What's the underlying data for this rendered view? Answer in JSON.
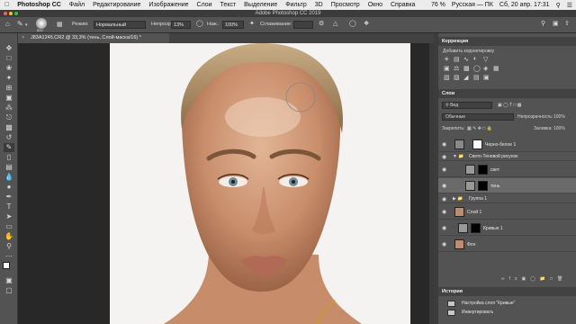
{
  "menubar": {
    "app": "Photoshop CC",
    "items": [
      "Файл",
      "Редактирование",
      "Изображение",
      "Слои",
      "Текст",
      "Выделение",
      "Фильтр",
      "3D",
      "Просмотр",
      "Окно",
      "Справка"
    ],
    "battery": "76 %",
    "keyboard": "Русская — ПК",
    "datetime": "Сб, 20 апр. 17:31"
  },
  "window": {
    "title": "Adobe Photoshop CC 2019"
  },
  "options": {
    "brush_size": "800",
    "mode_label": "Режим:",
    "mode_value": "Нормальный",
    "opacity_label": "Непрозр.:",
    "opacity_value": "13%",
    "pressure_label": "Наж.:",
    "pressure_value": "100%",
    "smoothing_label": "Сглаживание:"
  },
  "document": {
    "tab": "J83A1245.CR2 @ 33,3% (тень, Слой-маска/16) *"
  },
  "corrections": {
    "title": "Коррекция",
    "subtitle": "Добавить корректировку"
  },
  "layers": {
    "title": "Слои",
    "kind_label": "Вид",
    "blend_mode": "Обычные",
    "opacity_label": "Непрозрачность:",
    "opacity_value": "100%",
    "lock_label": "Закрепить:",
    "fill_label": "Заливка:",
    "fill_value": "100%",
    "rows": [
      {
        "name": "Черно-белое 1"
      },
      {
        "name": "Свето-Теневой рисунок"
      },
      {
        "name": "свет"
      },
      {
        "name": "тень"
      },
      {
        "name": "Группа 1"
      },
      {
        "name": "Слой 1"
      },
      {
        "name": "Кривые 1"
      },
      {
        "name": "Фон"
      }
    ]
  },
  "history": {
    "title": "История",
    "items": [
      "Настройка слоя \"Кривые\"",
      "Инвертировать"
    ]
  }
}
